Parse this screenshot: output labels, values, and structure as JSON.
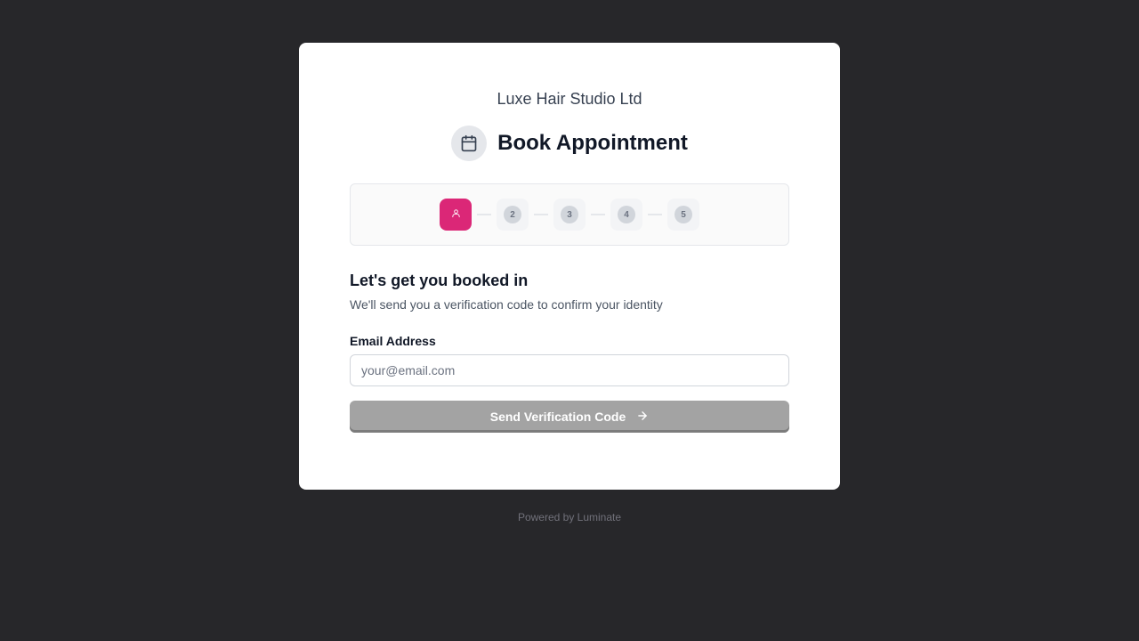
{
  "header": {
    "business_name": "Luxe Hair Studio Ltd",
    "title": "Book Appointment",
    "title_icon": "calendar-icon"
  },
  "stepper": {
    "active_step": 1,
    "active_icon": "user-icon",
    "steps": [
      "2",
      "3",
      "4",
      "5"
    ],
    "accent_color": "#db2777"
  },
  "form": {
    "heading": "Let's get you booked in",
    "description": "We'll send you a verification code to confirm your identity",
    "email_label": "Email Address",
    "email_value": "",
    "email_placeholder": "your@email.com",
    "submit_label": "Send Verification Code",
    "submit_icon": "arrow-right-icon"
  },
  "footer": {
    "text": "Powered by Luminate"
  }
}
